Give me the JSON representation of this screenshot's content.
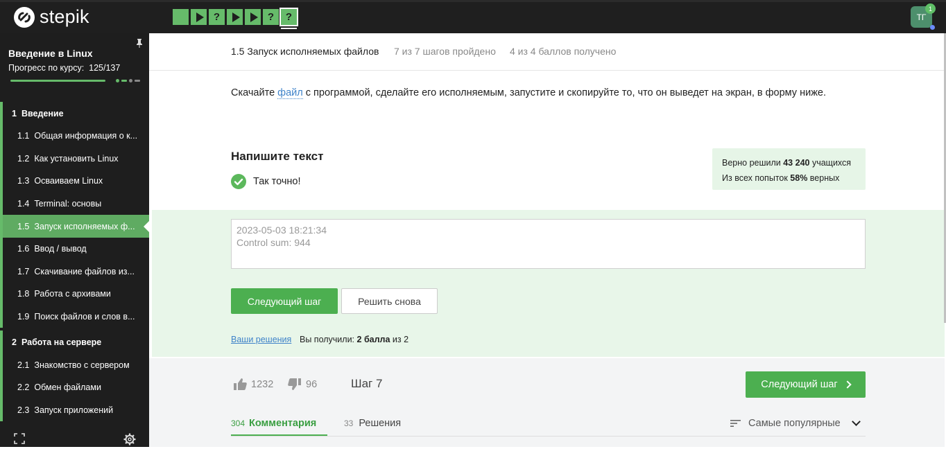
{
  "header": {
    "logo_text": "stepik",
    "steps": [
      {
        "type": "text",
        "symbol": ""
      },
      {
        "type": "video",
        "symbol": ""
      },
      {
        "type": "quiz",
        "symbol": "?"
      },
      {
        "type": "video",
        "symbol": ""
      },
      {
        "type": "video",
        "symbol": ""
      },
      {
        "type": "quiz",
        "symbol": "?"
      },
      {
        "type": "quiz",
        "symbol": "?",
        "active": true
      }
    ],
    "avatar_initials": "ТГ",
    "notification_count": "1"
  },
  "sidebar": {
    "course_title": "Введение в Linux",
    "progress_label": "Прогресс по курсу:",
    "progress_value": "125/137",
    "progress_fraction": 0.912,
    "sections": [
      {
        "num": "1",
        "title": "Введение",
        "items": [
          {
            "num": "1.1",
            "label": "Общая информация о к..."
          },
          {
            "num": "1.2",
            "label": "Как установить Linux"
          },
          {
            "num": "1.3",
            "label": "Осваиваем Linux"
          },
          {
            "num": "1.4",
            "label": "Terminal: основы"
          },
          {
            "num": "1.5",
            "label": "Запуск исполняемых ф...",
            "active": true
          },
          {
            "num": "1.6",
            "label": "Ввод / вывод"
          },
          {
            "num": "1.7",
            "label": "Скачивание файлов из..."
          },
          {
            "num": "1.8",
            "label": "Работа с архивами"
          },
          {
            "num": "1.9",
            "label": "Поиск файлов и слов в..."
          }
        ]
      },
      {
        "num": "2",
        "title": "Работа на сервере",
        "items": [
          {
            "num": "2.1",
            "label": "Знакомство с сервером"
          },
          {
            "num": "2.2",
            "label": "Обмен файлами"
          },
          {
            "num": "2.3",
            "label": "Запуск приложений"
          }
        ]
      }
    ]
  },
  "lesson": {
    "title": "1.5 Запуск исполняемых файлов",
    "steps_done": "7 из 7 шагов пройдено",
    "score": "4 из 4 баллов  получено"
  },
  "task": {
    "text_before": "Скачайте ",
    "link_text": "файл",
    "text_after": " с программой, сделайте его исполняемым, запустите и скопируйте то, что он выведет на экран, в форму ниже.",
    "quiz_title": "Напишите текст",
    "correct_text": "Так точно!",
    "stats_line1_prefix": "Верно решили ",
    "stats_line1_value": "43 240",
    "stats_line1_suffix": " учащихся",
    "stats_line2_prefix": "Из всех попыток ",
    "stats_line2_value": "58%",
    "stats_line2_suffix": " верных",
    "answer_line1": "2023-05-03 18:21:34",
    "answer_line2": "Control sum: 944",
    "next_button": "Следующий шаг",
    "retry_button": "Решить снова",
    "your_solutions": "Ваши решения",
    "got_prefix": "Вы получили: ",
    "got_value": "2 балла",
    "got_suffix": " из 2"
  },
  "footer": {
    "likes": "1232",
    "dislikes": "96",
    "step_label": "Шаг 7",
    "next_button": "Следующий шаг",
    "tabs": [
      {
        "count": "304",
        "label": "Комментария"
      },
      {
        "count": "33",
        "label": "Решения"
      }
    ],
    "sort_label": "Самые популярные"
  },
  "colors": {
    "accent": "#4caf50",
    "sidebar_bg": "#1e1e1e",
    "topbar_bg": "#1f1f1f",
    "answer_bg": "#e8f6e9",
    "link": "#3f83c9"
  }
}
